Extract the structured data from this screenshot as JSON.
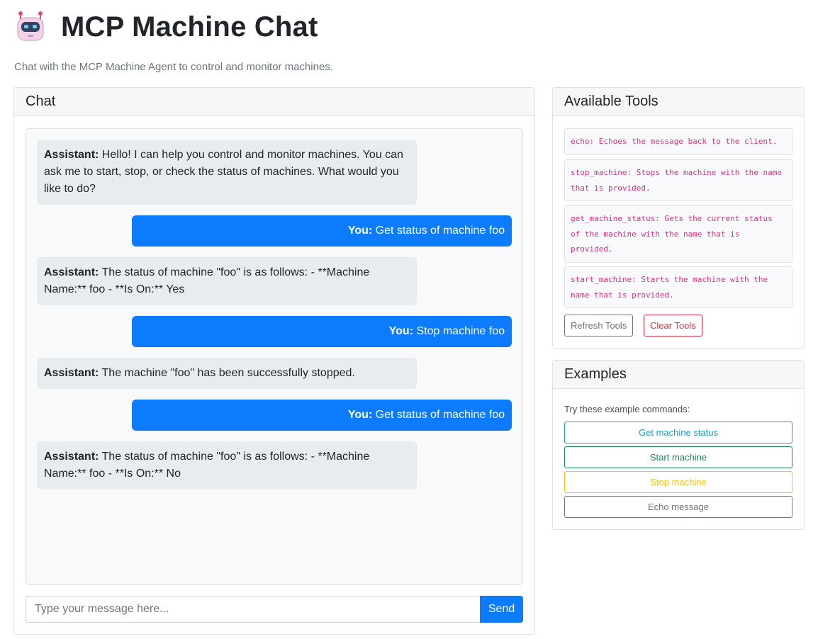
{
  "header": {
    "title": "MCP Machine Chat",
    "icon": "robot-icon",
    "subtitle": "Chat with the MCP Machine Agent to control and monitor machines."
  },
  "chat": {
    "header": "Chat",
    "messages": [
      {
        "role": "assistant",
        "speaker": "Assistant:",
        "text": " Hello! I can help you control and monitor machines. You can ask me to start, stop, or check the status of machines. What would you like to do?"
      },
      {
        "role": "user",
        "speaker": "You:",
        "text": " Get status of machine foo"
      },
      {
        "role": "assistant",
        "speaker": "Assistant:",
        "text": " The status of machine \"foo\" is as follows: - **Machine Name:** foo - **Is On:** Yes"
      },
      {
        "role": "user",
        "speaker": "You:",
        "text": " Stop machine foo"
      },
      {
        "role": "assistant",
        "speaker": "Assistant:",
        "text": " The machine \"foo\" has been successfully stopped."
      },
      {
        "role": "user",
        "speaker": "You:",
        "text": " Get status of machine foo"
      },
      {
        "role": "assistant",
        "speaker": "Assistant:",
        "text": " The status of machine \"foo\" is as follows: - **Machine Name:** foo - **Is On:** No"
      }
    ],
    "input_placeholder": "Type your message here...",
    "input_value": "",
    "send_label": "Send"
  },
  "tools": {
    "header": "Available Tools",
    "items": [
      "echo: Echoes the message back to the client.",
      "stop_machine: Stops the machine with the name that is provided.",
      "get_machine_status: Gets the current status of the machine with the name that is provided.",
      "start_machine: Starts the machine with the name that is provided."
    ],
    "refresh_label": "Refresh Tools",
    "clear_label": "Clear Tools"
  },
  "examples": {
    "header": "Examples",
    "intro": "Try these example commands:",
    "buttons": [
      {
        "label": "Get machine status",
        "color": "#17a2b8"
      },
      {
        "label": "Start machine",
        "color": "#198754"
      },
      {
        "label": "Stop machine",
        "color": "#ffc107"
      },
      {
        "label": "Echo message",
        "color": "#6c757d"
      }
    ]
  },
  "colors": {
    "primary": "#0d7bfd",
    "assistant_bubble": "#e9ecef",
    "code_text": "#d63384",
    "danger": "#dc3545"
  }
}
